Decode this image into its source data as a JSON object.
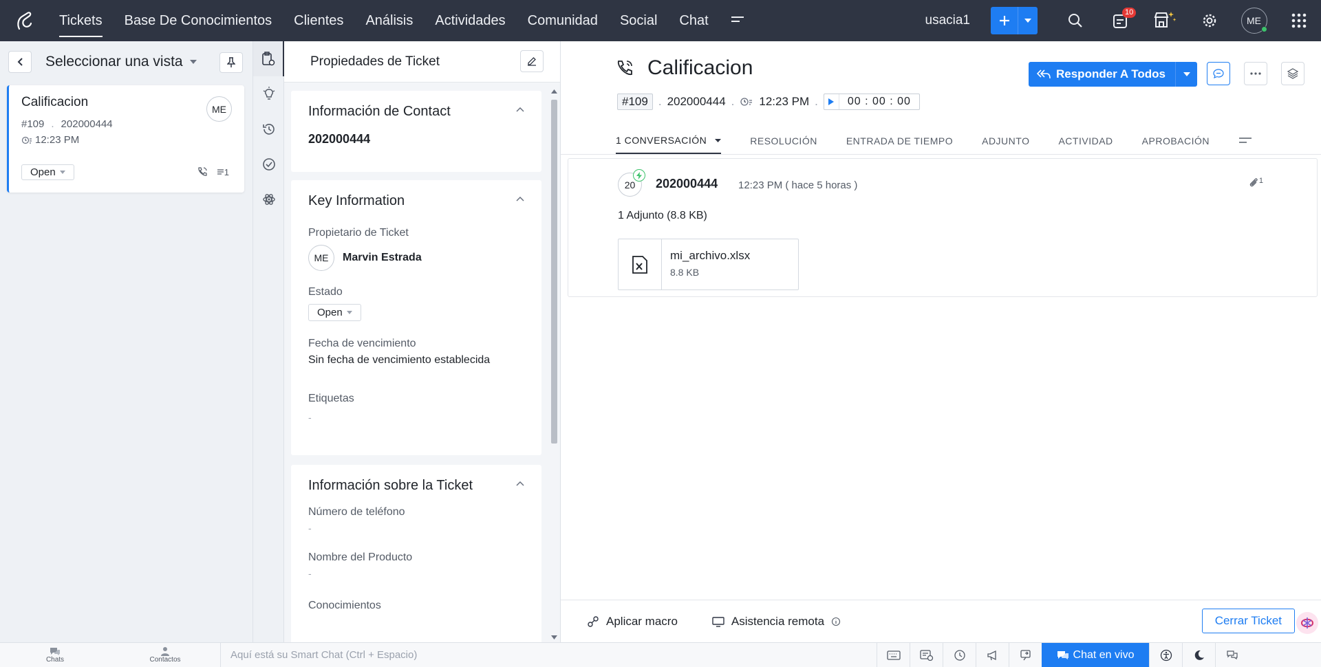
{
  "nav": {
    "items": [
      "Tickets",
      "Base De Conocimientos",
      "Clientes",
      "Análisis",
      "Actividades",
      "Comunidad",
      "Social",
      "Chat"
    ],
    "portal": "usacia1",
    "notification_count": "10",
    "user_initials": "ME"
  },
  "list": {
    "view_title": "Seleccionar una vista",
    "ticket": {
      "subject": "Calificacion",
      "id": "#109",
      "contact": "202000444",
      "time": "12:23 PM",
      "status": "Open",
      "owner_initials": "ME",
      "thread_count": "1"
    }
  },
  "props": {
    "title": "Propiedades de Ticket",
    "contact_section": {
      "title": "Información de Contact",
      "value": "202000444"
    },
    "key_section": {
      "title": "Key Information",
      "owner_label": "Propietario de Ticket",
      "owner_initials": "ME",
      "owner_name": "Marvin Estrada",
      "status_label": "Estado",
      "status_value": "Open",
      "due_label": "Fecha de vencimiento",
      "due_value": "Sin fecha de vencimiento establecida",
      "tags_label": "Etiquetas",
      "tags_value": "-"
    },
    "ticket_section": {
      "title": "Información sobre la Ticket",
      "phone_label": "Número de teléfono",
      "phone_value": "-",
      "product_label": "Nombre del Producto",
      "product_value": "-",
      "knowledge_label": "Conocimientos"
    }
  },
  "ticket": {
    "subject": "Calificacion",
    "id": "#109",
    "contact": "202000444",
    "time": "12:23 PM",
    "timer": "00 : 00 : 00",
    "reply_all": "Responder A Todos",
    "tabs": [
      "1 CONVERSACIÓN",
      "RESOLUCIÓN",
      "ENTRADA DE TIEMPO",
      "ADJUNTO",
      "ACTIVIDAD",
      "APROBACIÓN"
    ],
    "conversation": {
      "avatar": "20",
      "from": "202000444",
      "time": "12:23 PM ( hace 5 horas )",
      "clip_count": "1",
      "attachments_summary": "1  Adjunto  (8.8 KB)",
      "file_name": "mi_archivo.xlsx",
      "file_size": "8.8 KB"
    },
    "apply_macro": "Aplicar macro",
    "remote_assist": "Asistencia remota",
    "close_ticket": "Cerrar Ticket"
  },
  "footer": {
    "chats": "Chats",
    "contacts": "Contactos",
    "smartchat_placeholder": "Aquí está su Smart Chat (Ctrl + Espacio)",
    "live_chat": "Chat en vivo"
  },
  "colors": {
    "nav_bg": "#2f3543",
    "accent": "#1e7df2",
    "badge": "#e53935",
    "online": "#3cc26b"
  }
}
